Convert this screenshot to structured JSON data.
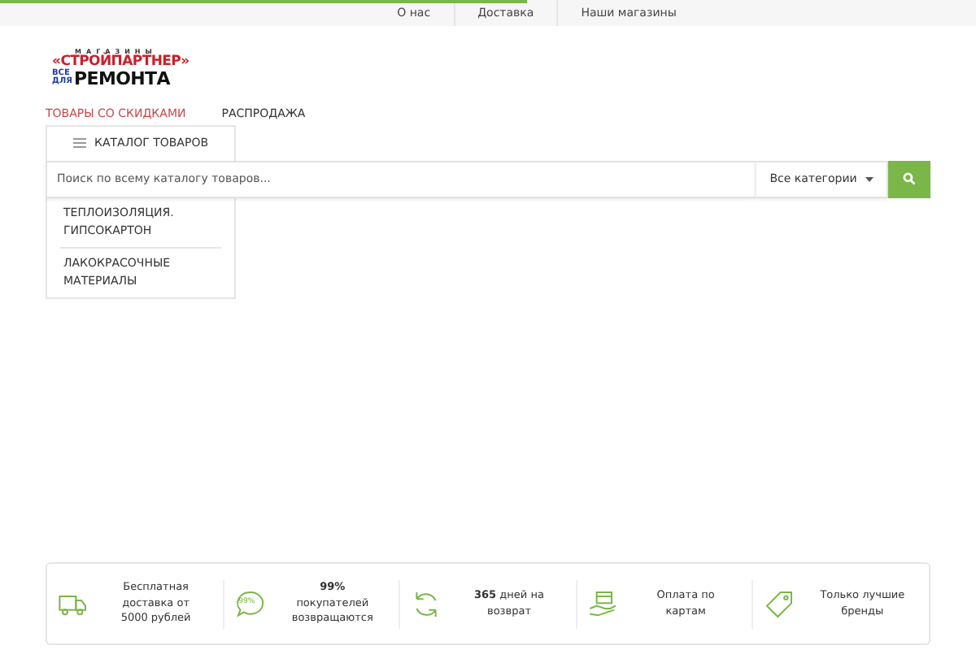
{
  "page_loader": {
    "level": 0.54
  },
  "top_links": [
    "О нас",
    "Доставка",
    "Наши магазины"
  ],
  "logo": {
    "top": "МАГАЗИНЫ",
    "name": "«СТРОЙПАРТНЕР»",
    "small_top": "ВСЕ",
    "small_bottom": "ДЛЯ",
    "big": "РЕМОНТА"
  },
  "nav": [
    {
      "label": "ТОВАРЫ СО СКИДКАМИ",
      "kind": "highlight"
    },
    {
      "label": "РАСПРОДАЖА",
      "kind": "plain"
    }
  ],
  "catalog_button": {
    "label": "КАТАЛОГ ТОВАРОВ"
  },
  "search": {
    "placeholder": "Поиск по всему каталогу товаров...",
    "category": "Все категории"
  },
  "catalog_menu": [
    "ТЕПЛОИЗОЛЯЦИЯ. ГИПСОКАРТОН",
    "ЛАКОКРАСОЧНЫЕ МАТЕРИАЛЫ"
  ],
  "features": [
    {
      "kind": "truck",
      "text": "Бесплатная доставка от 5000 рублей"
    },
    {
      "kind": "bubble",
      "badge": "99%",
      "text": "**99%** покупателей возвращаются"
    },
    {
      "kind": "refresh",
      "text": "**365** дней на возврат"
    },
    {
      "kind": "card",
      "text": "Оплата по картам"
    },
    {
      "kind": "tag",
      "text": "Только лучшие бренды"
    }
  ]
}
